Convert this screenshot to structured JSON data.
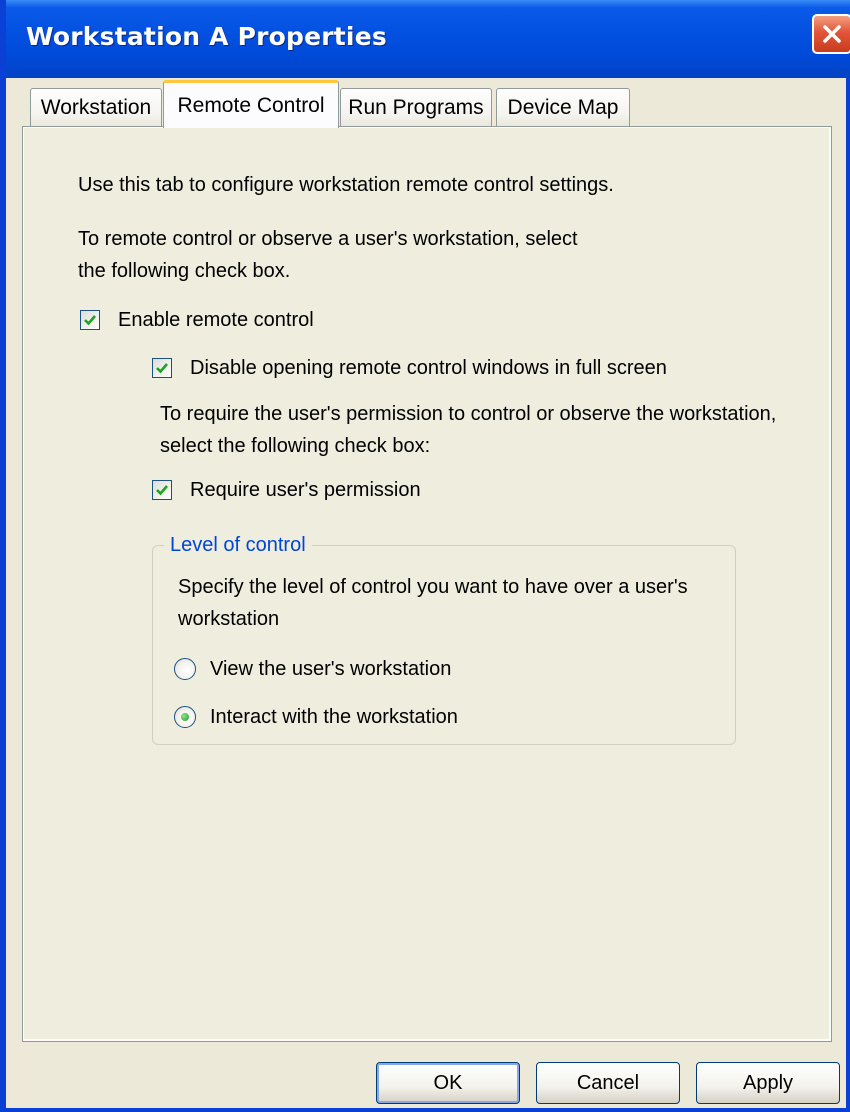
{
  "window": {
    "title": "Workstation A Properties"
  },
  "tabs": [
    {
      "label": "Workstation",
      "active": false
    },
    {
      "label": "Remote Control",
      "active": true
    },
    {
      "label": "Run Programs",
      "active": false
    },
    {
      "label": "Device Map",
      "active": false
    }
  ],
  "content": {
    "intro": "Use this tab to configure workstation remote control settings.",
    "instruction_line1": "To remote control or observe a user's workstation, select",
    "instruction_line2": "the following check box.",
    "enable_remote_control": {
      "label": "Enable remote control",
      "checked": true
    },
    "disable_full_screen": {
      "label": "Disable opening remote control windows in full screen",
      "checked": true
    },
    "permission_line1": "To require the user's permission to control or observe the workstation,",
    "permission_line2": "select the following check box:",
    "require_permission": {
      "label": "Require user's permission",
      "checked": true
    },
    "level_of_control": {
      "legend": "Level of control",
      "description_line1": "Specify the level of control you want to have over a user's",
      "description_line2": "workstation",
      "options": [
        {
          "label": "View the user's workstation",
          "selected": false
        },
        {
          "label": "Interact with the workstation",
          "selected": true
        }
      ]
    }
  },
  "buttons": {
    "ok": "OK",
    "cancel": "Cancel",
    "apply": "Apply"
  },
  "colors": {
    "titlebar": "#0350e0",
    "accent_tab": "#ffc83c",
    "group_legend": "#0046d5",
    "check": "#21a121"
  },
  "icons": {
    "close": "close-icon",
    "check": "checkmark-icon",
    "radio_dot": "radio-dot-icon"
  }
}
